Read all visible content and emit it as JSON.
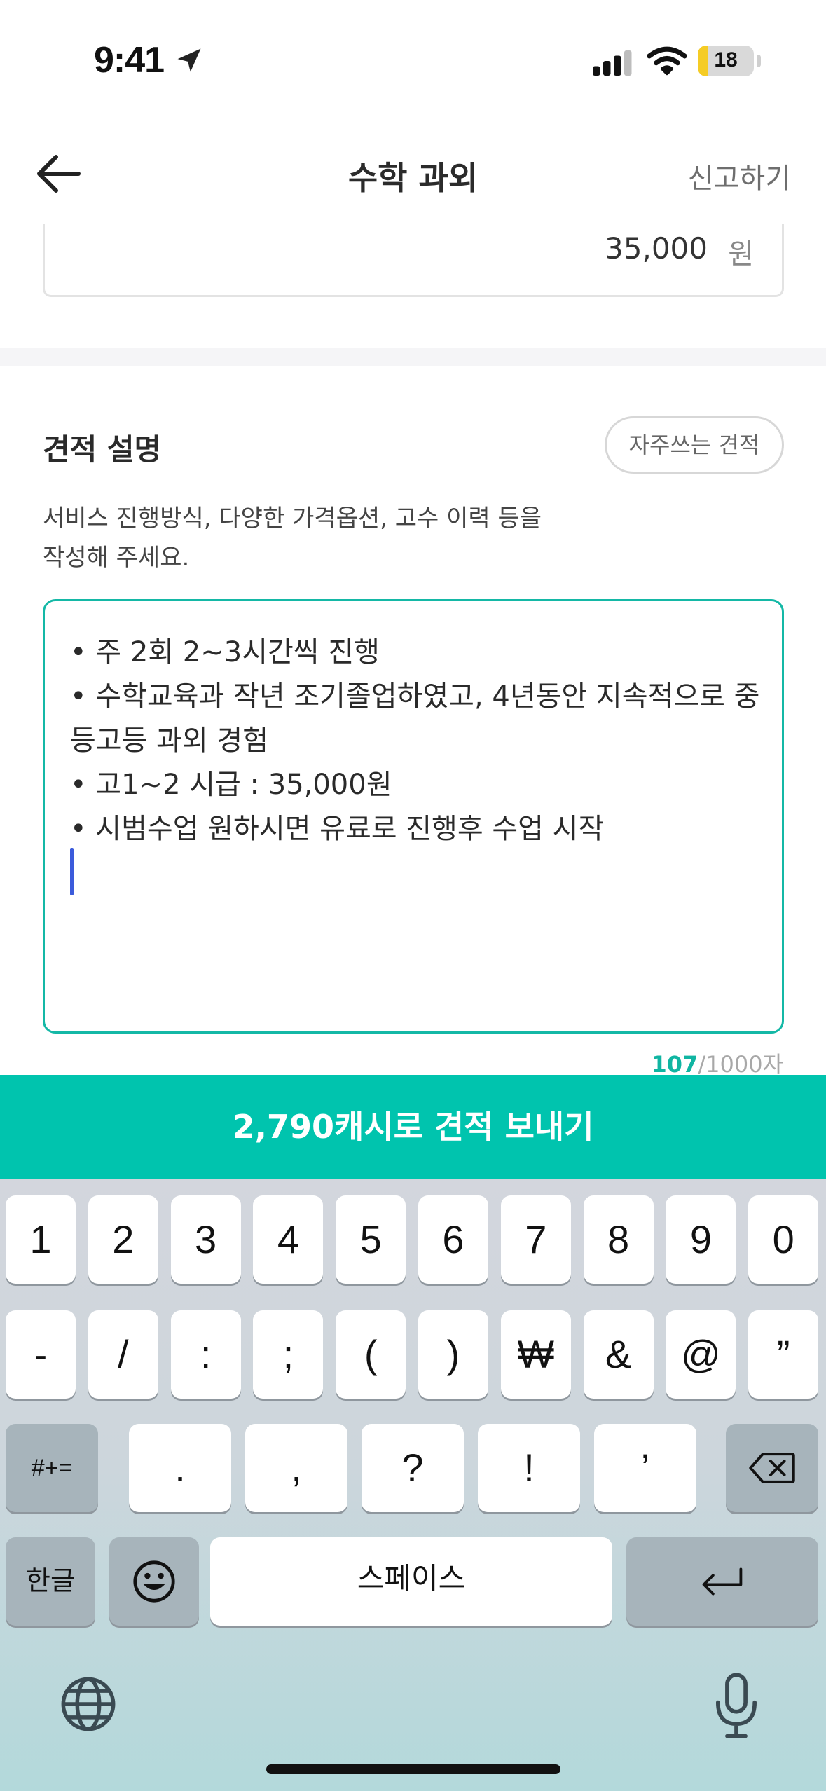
{
  "status_bar": {
    "time": "9:41",
    "battery_level": "18",
    "battery_fraction": 0.18,
    "icons": [
      "location-arrow-icon",
      "cellular-signal-icon",
      "wifi-icon",
      "battery-icon"
    ]
  },
  "nav": {
    "back_icon": "arrow-left-icon",
    "title": "수학 과외",
    "report_label": "신고하기"
  },
  "price": {
    "value": "35,000",
    "unit": "원"
  },
  "quote_description": {
    "title": "견적 설명",
    "frequent_button": "자주쓰는 견적",
    "helper_lines": [
      "서비스 진행방식, 다양한 가격옵션, 고수 이력 등을",
      "작성해 주세요."
    ],
    "lines": [
      "• 주 2회 2~3시간씩 진행",
      "• 수학교육과 작년 조기졸업하였고, 4년동안 지속적으로 중",
      "등고등 과외 경험",
      "• 고1~2 시급 : 35,000원",
      "• 시범수업 원하시면 유료로 진행후 수업 시작"
    ],
    "char_count": "107",
    "char_limit": "/1000자"
  },
  "send_button": "2,790캐시로 견적 보내기",
  "keyboard": {
    "row1": [
      "1",
      "2",
      "3",
      "4",
      "5",
      "6",
      "7",
      "8",
      "9",
      "0"
    ],
    "row2": [
      "-",
      "/",
      ":",
      ";",
      "(",
      ")",
      "₩",
      "&",
      "@",
      "”"
    ],
    "row3": [
      ".",
      ",",
      "?",
      "!",
      "’"
    ],
    "symbols_key": "#+=",
    "language_key": "한글",
    "space_key": "스페이스",
    "icons": [
      "delete-icon",
      "emoji-icon",
      "return-icon",
      "globe-icon",
      "microphone-icon"
    ]
  },
  "colors": {
    "accent": "#00c4ae",
    "textarea_border": "#14b8a6",
    "caret": "#3b5bdb",
    "counter_accent": "#10b5a2"
  }
}
